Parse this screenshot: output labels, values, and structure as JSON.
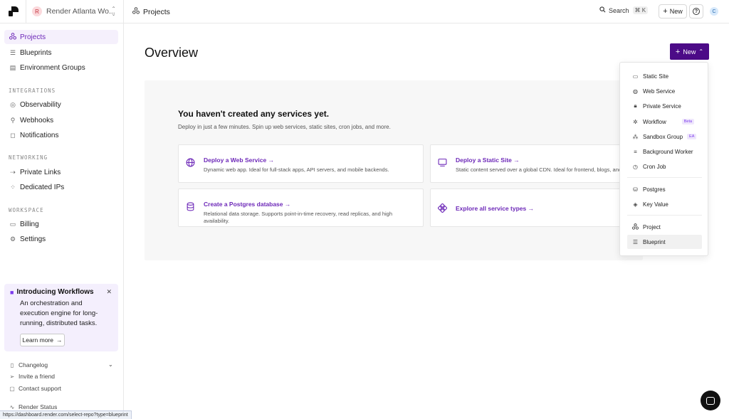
{
  "topbar": {
    "workspace_initial": "R",
    "workspace_name": "Render Atlanta Wo...",
    "breadcrumb": "Projects",
    "search_label": "Search",
    "search_shortcut": "⌘ K",
    "new_label": "New",
    "user_initial": "C"
  },
  "sidebar": {
    "items": [
      {
        "label": "Projects",
        "icon": "projects-icon"
      },
      {
        "label": "Blueprints",
        "icon": "blueprints-icon"
      },
      {
        "label": "Environment Groups",
        "icon": "environment-groups-icon"
      }
    ],
    "sections": {
      "integrations": "INTEGRATIONS",
      "networking": "NETWORKING",
      "workspace": "WORKSPACE"
    },
    "integrations": [
      {
        "label": "Observability",
        "icon": "observability-icon"
      },
      {
        "label": "Webhooks",
        "icon": "webhooks-icon"
      },
      {
        "label": "Notifications",
        "icon": "notifications-icon"
      }
    ],
    "networking": [
      {
        "label": "Private Links",
        "icon": "private-links-icon"
      },
      {
        "label": "Dedicated IPs",
        "icon": "dedicated-ips-icon"
      }
    ],
    "workspace": [
      {
        "label": "Billing",
        "icon": "billing-icon"
      },
      {
        "label": "Settings",
        "icon": "settings-icon"
      }
    ],
    "promo": {
      "title": "Introducing Workflows",
      "body": "An orchestration and execution engine for long-running, distributed tasks.",
      "button": "Learn more"
    },
    "footer": {
      "changelog": "Changelog",
      "invite": "Invite a friend",
      "support": "Contact support",
      "status": "Render Status"
    }
  },
  "main": {
    "title": "Overview",
    "new_button": "New",
    "empty_title": "You haven't created any services yet.",
    "empty_subtitle": "Deploy in just a few minutes. Spin up web services, static sites, cron jobs, and more.",
    "cards": [
      {
        "title": "Deploy a Web Service",
        "desc": "Dynamic web app. Ideal for full-stack apps, API servers, and mobile backends.",
        "icon": "globe-icon"
      },
      {
        "title": "Deploy a Static Site",
        "desc": "Static content served over a global CDN. Ideal for frontend, blogs, and",
        "icon": "static-site-icon"
      },
      {
        "title": "Create a Postgres database",
        "desc": "Relational data storage. Supports point-in-time recovery, read replicas, and high availability.",
        "icon": "database-icon"
      },
      {
        "title": "Explore all service types",
        "desc": "",
        "icon": "service-types-icon"
      }
    ]
  },
  "dropdown": {
    "items": [
      {
        "label": "Static Site"
      },
      {
        "label": "Web Service"
      },
      {
        "label": "Private Service"
      },
      {
        "label": "Workflow",
        "badge": "Beta"
      },
      {
        "label": "Sandbox Group",
        "badge": "EA"
      },
      {
        "label": "Background Worker"
      },
      {
        "label": "Cron Job"
      },
      {
        "label": "Postgres"
      },
      {
        "label": "Key Value"
      },
      {
        "label": "Project"
      },
      {
        "label": "Blueprint"
      }
    ]
  },
  "status_url": "https://dashboard.render.com/select-repo?type=blueprint",
  "colors": {
    "accent": "#6d28b8",
    "new_button_bg": "#4c0b87",
    "active_nav_bg": "#f5f0fc",
    "promo_bg": "#f4effd"
  }
}
